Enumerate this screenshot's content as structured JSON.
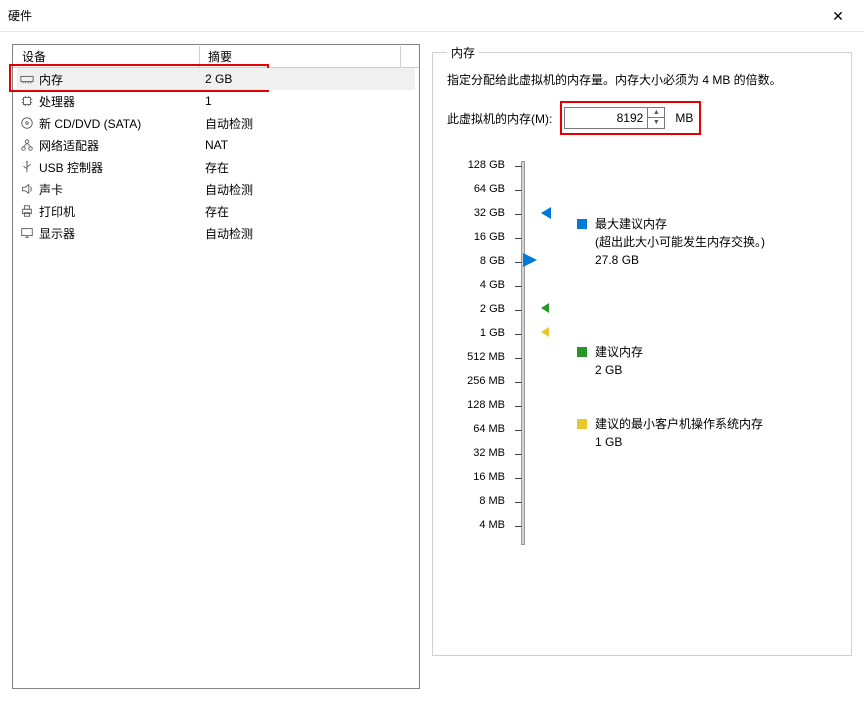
{
  "window": {
    "title": "硬件"
  },
  "table": {
    "header_device": "设备",
    "header_summary": "摘要"
  },
  "devices": [
    {
      "icon": "memory-icon",
      "name": "内存",
      "summary": "2 GB",
      "selected": true
    },
    {
      "icon": "cpu-icon",
      "name": "处理器",
      "summary": "1"
    },
    {
      "icon": "cd-icon",
      "name": "新 CD/DVD (SATA)",
      "summary": "自动检测"
    },
    {
      "icon": "network-icon",
      "name": "网络适配器",
      "summary": "NAT"
    },
    {
      "icon": "usb-icon",
      "name": "USB 控制器",
      "summary": "存在"
    },
    {
      "icon": "sound-icon",
      "name": "声卡",
      "summary": "自动检测"
    },
    {
      "icon": "printer-icon",
      "name": "打印机",
      "summary": "存在"
    },
    {
      "icon": "display-icon",
      "name": "显示器",
      "summary": "自动检测"
    }
  ],
  "memory_panel": {
    "legend": "内存",
    "description": "指定分配给此虚拟机的内存量。内存大小必须为 4 MB 的倍数。",
    "input_label": "此虚拟机的内存(M):",
    "input_value": "8192",
    "unit": "MB"
  },
  "slider_ticks": [
    "128 GB",
    "64 GB",
    "32 GB",
    "16 GB",
    "8 GB",
    "4 GB",
    "2 GB",
    "1 GB",
    "512 MB",
    "256 MB",
    "128 MB",
    "64 MB",
    "32 MB",
    "16 MB",
    "8 MB",
    "4 MB"
  ],
  "legend_markers": {
    "max_title": "最大建议内存",
    "max_note": "(超出此大小可能发生内存交换。)",
    "max_value": "27.8 GB",
    "rec_title": "建议内存",
    "rec_value": "2 GB",
    "min_title": "建议的最小客户机操作系统内存",
    "min_value": "1 GB"
  }
}
